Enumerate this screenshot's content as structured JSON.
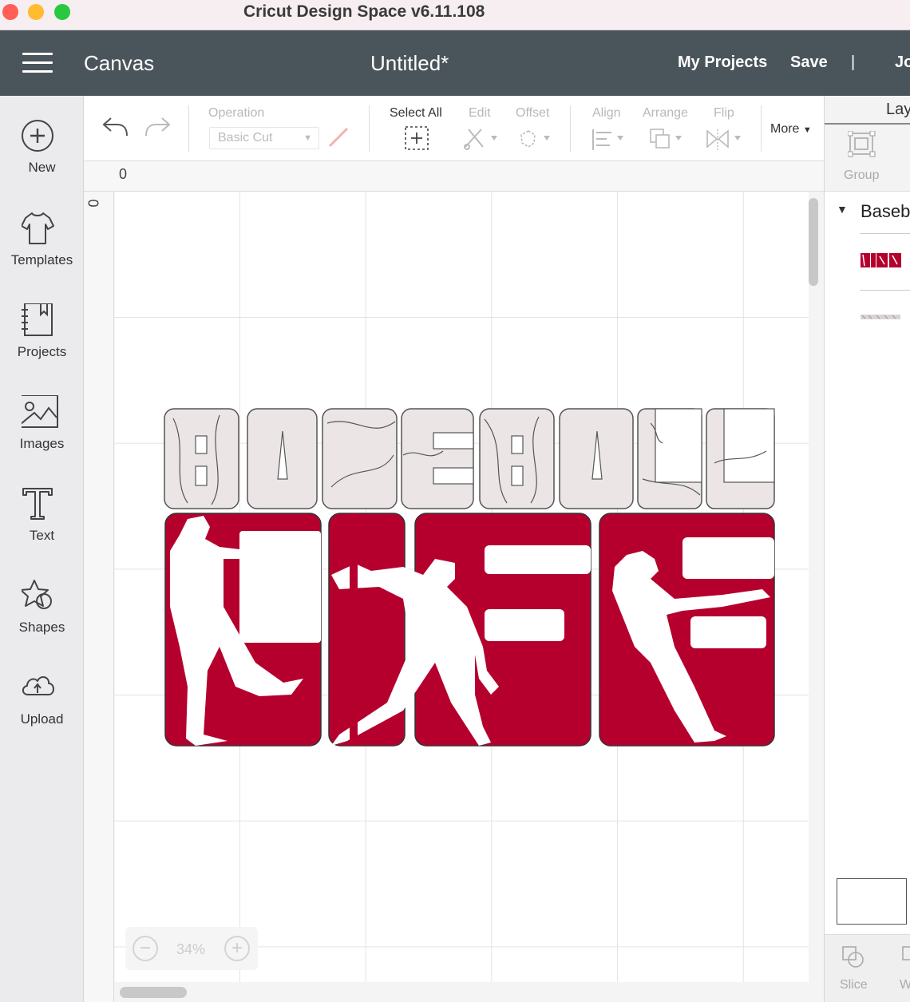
{
  "window": {
    "title": "Cricut Design Space  v6.11.108"
  },
  "header": {
    "section": "Canvas",
    "doc_title": "Untitled*",
    "my_projects": "My Projects",
    "save": "Save",
    "separator": "|",
    "make": "Jo"
  },
  "sidebar": {
    "items": [
      {
        "label": "New",
        "icon": "plus-circle-icon"
      },
      {
        "label": "Templates",
        "icon": "tshirt-icon"
      },
      {
        "label": "Projects",
        "icon": "notebook-icon"
      },
      {
        "label": "Images",
        "icon": "image-icon"
      },
      {
        "label": "Text",
        "icon": "text-t-icon"
      },
      {
        "label": "Shapes",
        "icon": "shapes-icon"
      },
      {
        "label": "Upload",
        "icon": "cloud-upload-icon"
      }
    ]
  },
  "toolbar": {
    "operation_label": "Operation",
    "operation_value": "Basic Cut",
    "select_all": "Select All",
    "edit": "Edit",
    "offset": "Offset",
    "align": "Align",
    "arrange": "Arrange",
    "flip": "Flip",
    "more": "More"
  },
  "ruler": {
    "top_zero": "0",
    "left_zero": "0"
  },
  "zoom": {
    "value": "34%",
    "minus": "−",
    "plus": "+"
  },
  "artwork": {
    "word1": "BASEBALL",
    "word2": "LIFE",
    "fill_light": "#ebe5e5",
    "fill_red": "#b5002e"
  },
  "right_panel": {
    "tab": "Layers",
    "group_label": "Group",
    "layer_group_name": "Baseball",
    "slice_label": "Slice",
    "weld_label": "W"
  },
  "colors": {
    "header": "#4a545b",
    "accent_red": "#b5002e"
  }
}
